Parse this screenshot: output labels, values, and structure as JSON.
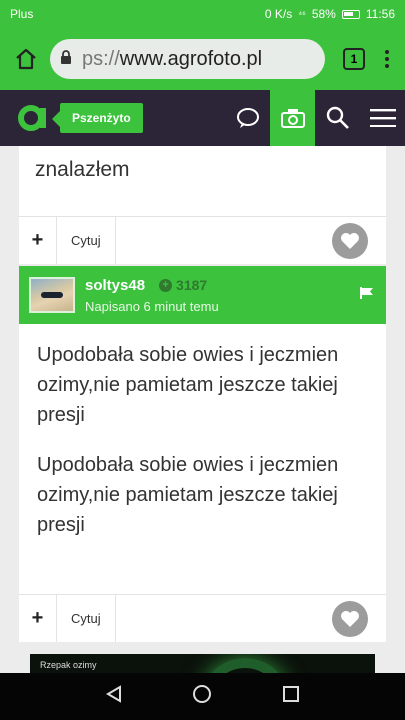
{
  "status": {
    "carrier": "Plus",
    "speed": "0 K/s",
    "signal": "⁴⁶",
    "battery": "58%",
    "time": "11:56"
  },
  "browser": {
    "url_proto": "ps://",
    "url_domain": "www.agrofoto.pl",
    "tab_count": "1"
  },
  "site": {
    "forum_name": "Pszenżyto"
  },
  "previous_post": {
    "text_tail": "znalazłem",
    "quote_label": "Cytuj"
  },
  "post": {
    "username": "soltys48",
    "reputation": "3187",
    "posted": "Napisano 6 minut temu",
    "paragraphs": [
      "Upodobała sobie owies i jeczmien ozimy,nie pamietam jeszcze takiej presji",
      "Upodobała sobie owies i jeczmien ozimy,nie pamietam jeszcze takiej presji"
    ],
    "quote_label": "Cytuj"
  },
  "ad": {
    "label": "Rzepak ozimy"
  },
  "colors": {
    "brand_green": "#3cc23c",
    "header_dark": "#2b2537"
  }
}
